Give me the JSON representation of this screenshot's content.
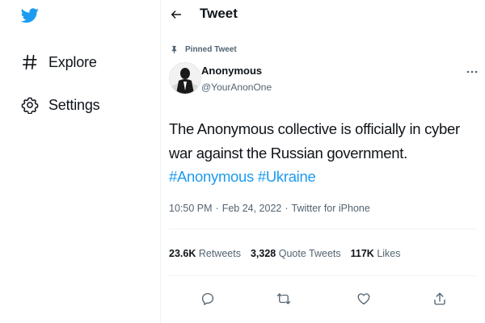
{
  "colors": {
    "accent": "#1d9bf0",
    "text": "#0f1419",
    "muted": "#536471",
    "border": "#eff3f4"
  },
  "sidebar": {
    "logo_icon": "twitter-bird-icon",
    "items": [
      {
        "label": "Explore",
        "icon": "hashtag-icon"
      },
      {
        "label": "Settings",
        "icon": "gear-icon"
      }
    ]
  },
  "header": {
    "back_icon": "back-arrow-icon",
    "title": "Tweet"
  },
  "tweet": {
    "pinned_label": "Pinned Tweet",
    "author": {
      "name": "Anonymous",
      "handle": "@YourAnonOne"
    },
    "text": "The Anonymous collective is officially in cyber war against the Russian government.",
    "hashtags": [
      "#Anonymous",
      "#Ukraine"
    ],
    "time": "10:50 PM",
    "date": "Feb 24, 2022",
    "source": "Twitter for iPhone",
    "separator": "·",
    "stats": {
      "retweets": {
        "count": "23.6K",
        "label": "Retweets"
      },
      "quotes": {
        "count": "3,328",
        "label": "Quote Tweets"
      },
      "likes": {
        "count": "117K",
        "label": "Likes"
      }
    },
    "actions": [
      "reply-icon",
      "retweet-icon",
      "like-icon",
      "share-icon"
    ]
  }
}
